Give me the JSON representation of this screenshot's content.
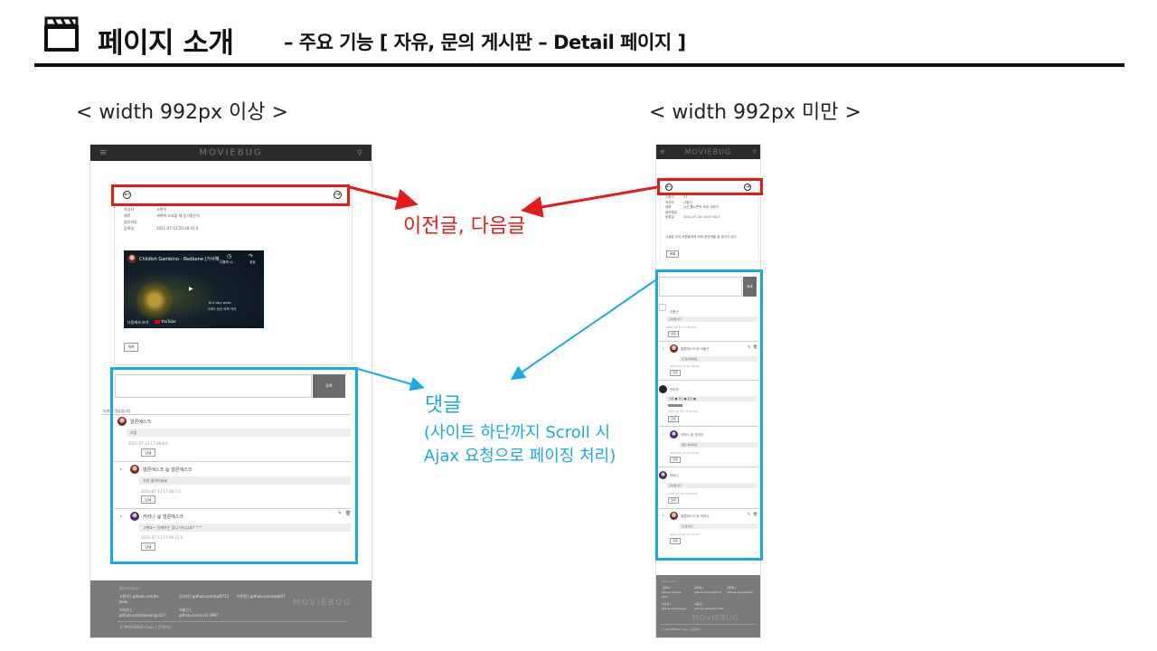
{
  "header": {
    "title": "페이지 소개",
    "subtitle": "– 주요 기능 [ 자유, 문의 게시판 – Detail 페이지 ]"
  },
  "sections": {
    "wide_label": "< width 992px 이상 >",
    "narrow_label": "< width 992px 미만 >"
  },
  "annotations": {
    "prev_next": "이전글, 다음글",
    "comments_title": "댓글",
    "comments_line1": "(사이트 하단까지 Scroll 시",
    "comments_line2": "Ajax 요청으로 페이징 처리)"
  },
  "colors": {
    "red": "#e31b1b",
    "blue": "#1aa9e6",
    "navbar": "#2b2b2b",
    "footer": "#7a7a7a"
  },
  "icons": {
    "clapper": "clapperboard-icon",
    "prev": "arrow-left-circle-icon",
    "next": "arrow-right-circle-icon",
    "menu": "hamburger-icon",
    "search": "search-icon"
  },
  "wide": {
    "logo": "MOVIEBUG",
    "post": {
      "r1_label": "작성자",
      "r1_value": "고현석",
      "r2_label": "제목",
      "r2_value": "새벽에 조요할 때 듣기좋은곡",
      "r3_label": "첨부파일",
      "r4_label": "등록일",
      "r4_value": "2021-07-12 20:18:31.0"
    },
    "video": {
      "title": "Childish Gambino - Redbone [가사해...",
      "watch_later": "나중에 시...",
      "share": "공유",
      "watch_on": "다음에서 보기",
      "yt": "YouTube",
      "cap1": "But stay woke",
      "cap2": "그래도 정신 바짝 차려"
    },
    "list_btn": "목록",
    "comment_submit": "등록",
    "comment_notice": "비개된 댓글입니다",
    "comments": [
      {
        "author": "얼른에스크",
        "text": "조용",
        "date": "2021-07-13 17:48:8.0",
        "reply": "답글"
      },
      {
        "author": "얼른에스크 @ 얼른에스크",
        "text": "가연 좋아이네요",
        "date": "2021-07-13 17:48:7.0",
        "reply": "답글"
      },
      {
        "author": "카리나 @ 얼른에스크",
        "text": "그렇죠~ 진짜가는 겁니 어디니요? ^^",
        "date": "2021-07-13 17:49:31.0",
        "reply": "답글"
      }
    ],
    "footer": {
      "heading": "Developers",
      "dev1": "고현석 | github.com/hs",
      "dev1b": "koko",
      "dev2": "김다연 | github.com/dyl0712",
      "dev3": "이주현 | github.com/seah97",
      "dev4": "이다은 |",
      "dev4b": "github.com/dayeong1227",
      "dev5": "이충근 |",
      "dev5b": "github.com/cs2c1997",
      "logo": "MOVIEBUG",
      "copyright": "© MOVIEBUG Corp. | 문의하기"
    }
  },
  "narrow": {
    "logo": "MOVIEBUG",
    "post": {
      "r0_label": "고현석",
      "r0_value": "31",
      "r1_label": "작성자",
      "r1_value": "고현석",
      "r2_label": "제목",
      "r2_value": "나는 롤시즌의 조장 고현석",
      "r3_label": "첨부파일",
      "r4_label": "등록일",
      "r4_value": "2021-07-14 14:57:02.0",
      "body": "고생한 우리 조원들에게 커피 한잔씩을 쏠 생각이 있다."
    },
    "list_btn": "목록",
    "comment_submit": "등록",
    "comments": [
      {
        "author": "이충근",
        "text": "감사합니다",
        "date": "2021-07-15 17:49:6.0",
        "reply": "답글"
      },
      {
        "author": "얼른에스크 @ 이충근",
        "text": "헐 감사하네요",
        "date": "2021-07-15 17:49:8.0",
        "reply": "답글"
      },
      {
        "author": "관리자",
        "text": "댓글 ■ 최선 ■ 등급 ■",
        "date": "2021-07-15 17:50:6.0",
        "reply": "답글"
      },
      {
        "author": "카리나 @ 관리자",
        "text": "정신 차려세요",
        "date": "2021-07-15 17:51:9.0",
        "reply": "답글"
      },
      {
        "author": "카리나",
        "text": "감사합니다",
        "date": "2021-07-15 17:52:6.0",
        "reply": "답글"
      },
      {
        "author": "얼른에스크 @ 카리나",
        "text": "헐 감사요",
        "date": "2021-07-15 17:53:6.0",
        "reply": "답글"
      }
    ],
    "footer": {
      "heading": "Developers",
      "c1": "고현석 |",
      "c1b": "github.com/hs",
      "c1c": "koko",
      "c2": "김다연 |",
      "c2b": "github.com/dyl0712",
      "c3": "이주현 |",
      "c3b": "github.com/seah97",
      "c4": "이다은 |",
      "c4b": "github.com/dayeo",
      "c5": "이충근 |",
      "c5b": "github.com/cs2c1997",
      "logo": "MOVIEBUG",
      "copyright": "© MOVIEBUG Corp. | 문의하기"
    }
  }
}
